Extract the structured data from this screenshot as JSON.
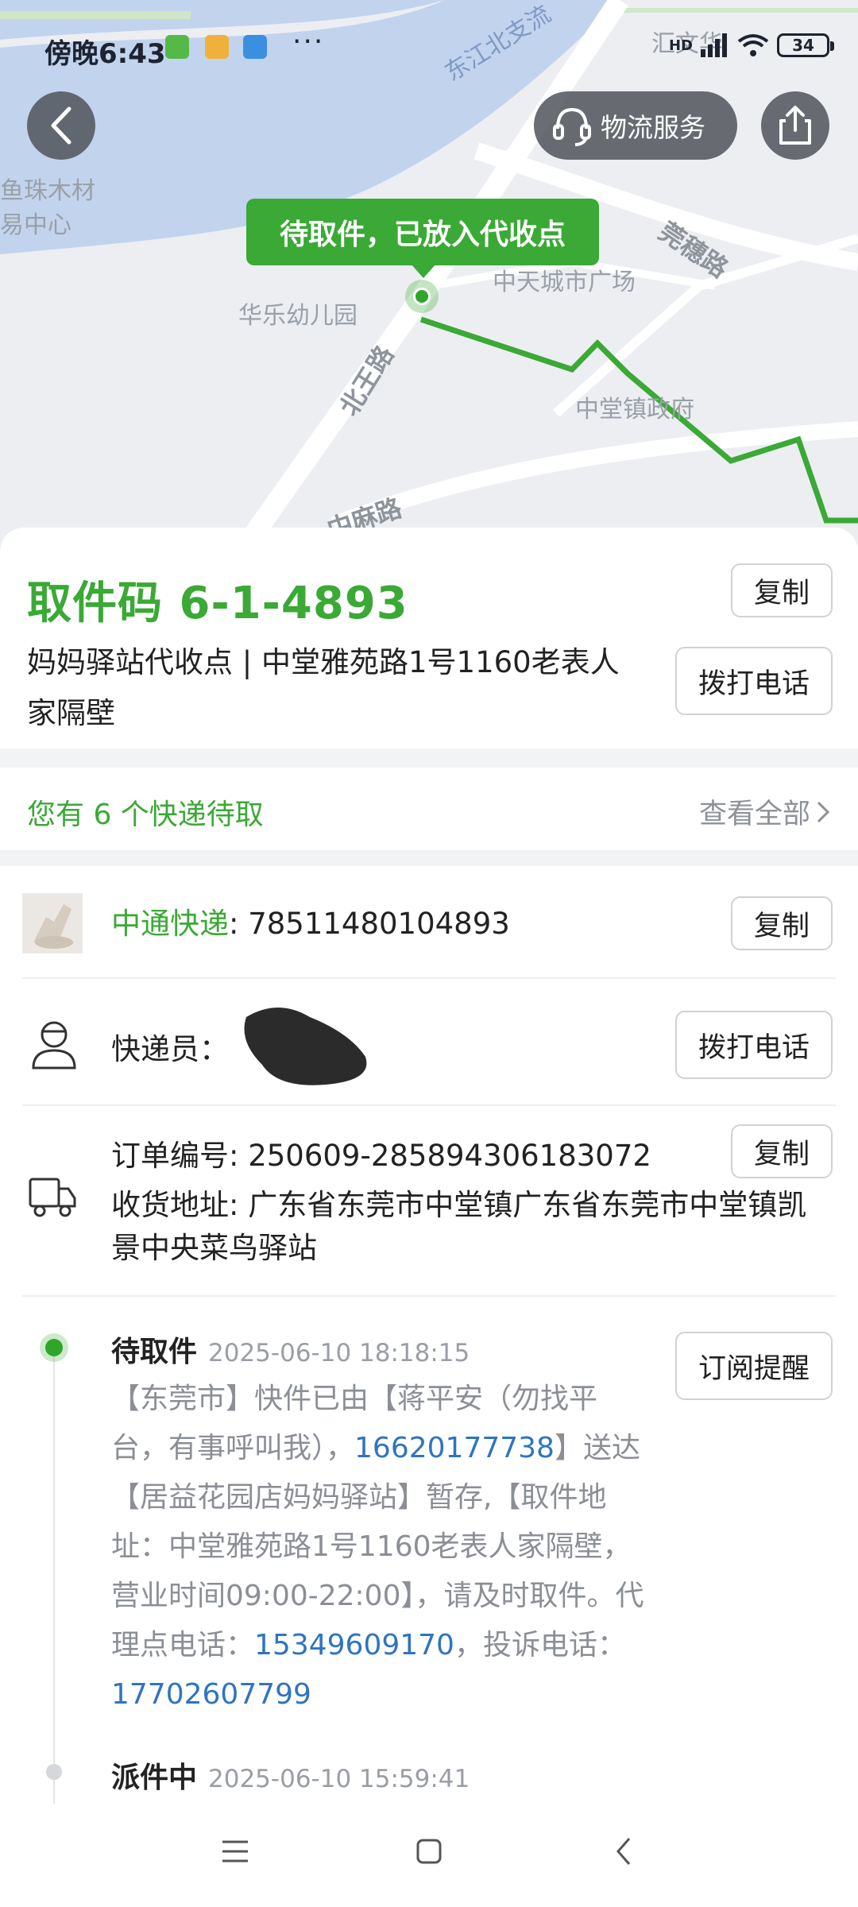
{
  "status_bar": {
    "time": "傍晚6:43",
    "more": "···",
    "network": "HD",
    "battery": "34"
  },
  "map": {
    "labels": {
      "river": "东江北支流",
      "wood_market_1": "鱼珠木材",
      "wood_market_2": "易中心",
      "school": "华乐幼儿园",
      "plaza": "中天城市广场",
      "gov": "中堂镇政府",
      "road_beiwang": "北王路",
      "road_guansui": "莞穗路",
      "road_zhongma": "中麻路",
      "partial_top": "汇文华"
    },
    "bubble": "待取件，已放入代收点",
    "route_color": "#3aa935"
  },
  "header": {
    "logistics_service": "物流服务"
  },
  "pickup": {
    "code": "取件码 6-1-4893",
    "address": "妈妈驿站代收点 | 中堂雅苑路1号1160老表人家隔壁",
    "copy_label": "复制",
    "call_label": "拨打电话"
  },
  "pending": {
    "text": "您有 6 个快递待取",
    "view_all": "查看全部"
  },
  "parcel": {
    "carrier": "中通快递",
    "tracking_no": ": 78511480104893",
    "copy_label": "复制",
    "courier_label": "快递员：",
    "call_label": "拨打电话",
    "order_no": "订单编号: 250609-285894306183072",
    "order_copy_label": "复制",
    "address": "收货地址: 广东省东莞市中堂镇广东省东莞市中堂镇凯景中央菜鸟驿站"
  },
  "timeline": {
    "subscribe_label": "订阅提醒",
    "events": [
      {
        "status": "待取件",
        "time": "2025-06-10 18:18:15",
        "body_1": "【东莞市】快件已由【蒋平安（勿找平台，有事呼叫我），",
        "phone_1": "16620177738",
        "body_2": "】送达【居益花园店妈妈驿站】暂存,【取件地址：中堂雅苑路1号1160老表人家隔壁，营业时间09:00-22:00】，请及时取件。代理点电话：",
        "phone_2": "15349609170",
        "body_3": "，投诉电话：",
        "phone_3": "17702607799"
      },
      {
        "status": "派件中",
        "time": "2025-06-10 15:59:41"
      }
    ]
  },
  "colors": {
    "accent": "#3aa935",
    "link": "#2f74c0",
    "muted": "#8b8f95"
  }
}
